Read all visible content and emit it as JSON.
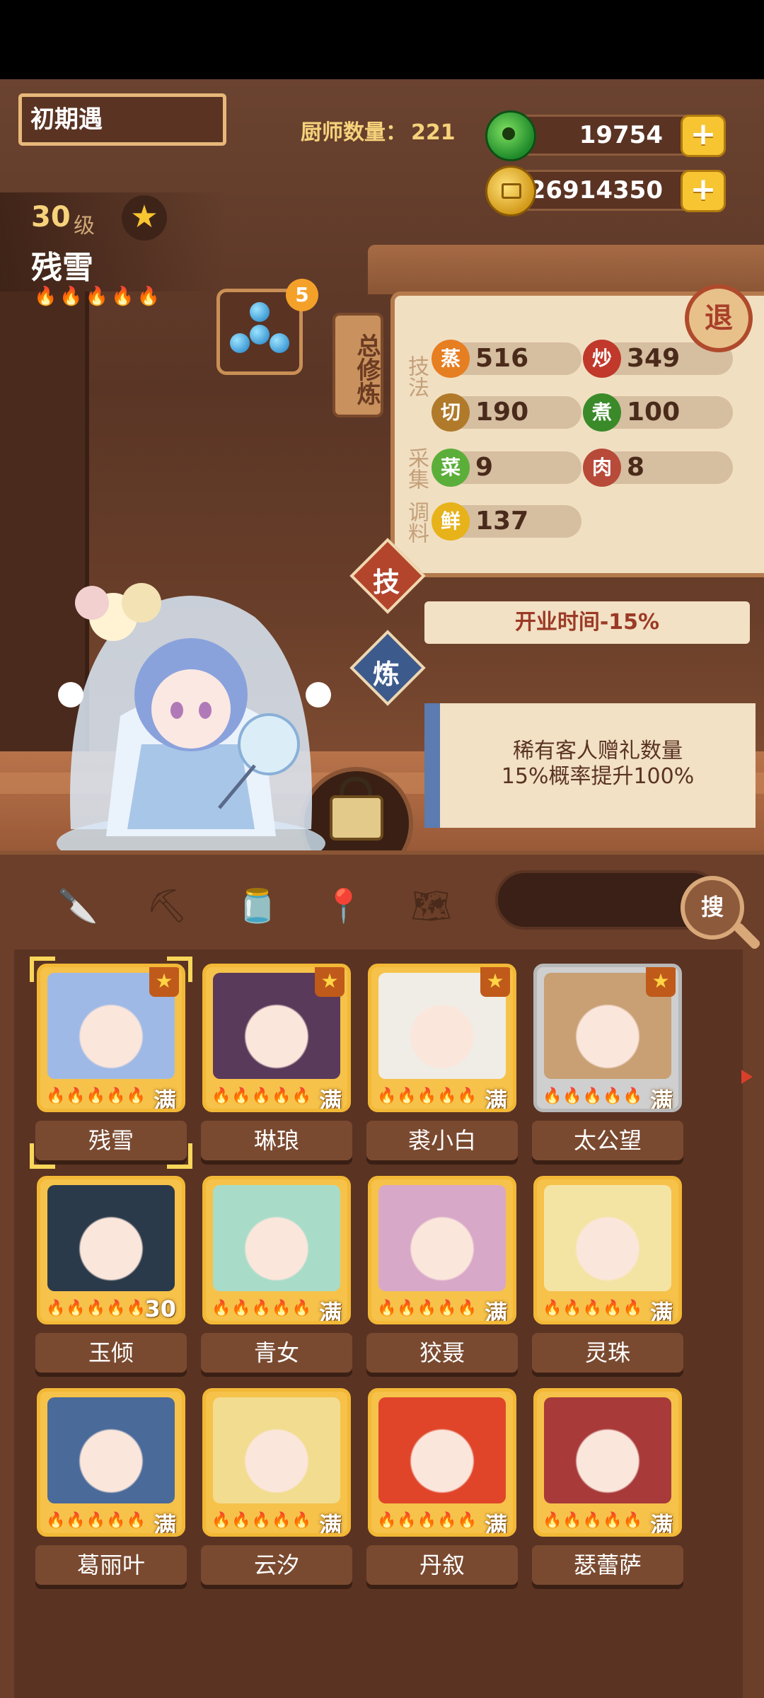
{
  "header": {
    "title": "初期遇",
    "chef_count_label": "厨师数量：",
    "chef_count_value": "221"
  },
  "currency": {
    "jade": "19754",
    "coins": "26914350",
    "plus_label": "+"
  },
  "chef": {
    "level": "30",
    "level_unit": "级",
    "name": "残雪",
    "flames": "🔥🔥🔥🔥🔥",
    "equipment_count": "5"
  },
  "cultivation": {
    "tab_label": "总修炼",
    "section_skill": "技法",
    "section_gather": "采集",
    "section_season": "调料",
    "stats": [
      {
        "icon": "蒸",
        "value": "516",
        "color": "#e67e22"
      },
      {
        "icon": "炒",
        "value": "349",
        "color": "#c0392b"
      },
      {
        "icon": "切",
        "value": "190",
        "color": "#b07a2a"
      },
      {
        "icon": "煮",
        "value": "100",
        "color": "#3a8a2a"
      },
      {
        "icon": "菜",
        "value": "9",
        "color": "#5cae3a"
      },
      {
        "icon": "肉",
        "value": "8",
        "color": "#b84a3a"
      },
      {
        "icon": "鲜",
        "value": "137",
        "color": "#e7b21a"
      }
    ]
  },
  "actions": {
    "skill_label": "技",
    "refine_label": "炼",
    "back_label": "退",
    "skill_effect": "开业时间-15%",
    "refine_line1": "稀有客人赠礼数量",
    "refine_line2": "15%概率提升100%"
  },
  "filters": {
    "icons": [
      "knife-filter-icon",
      "shovel-filter-icon",
      "jar-filter-icon",
      "location-filter-icon",
      "map-filter-icon"
    ],
    "search_label": "搜"
  },
  "chef_list": [
    {
      "name": "残雪",
      "badge": "满",
      "color": "#9fb9e6"
    },
    {
      "name": "琳琅",
      "badge": "满",
      "color": "#5a3a5a"
    },
    {
      "name": "裘小白",
      "badge": "满",
      "color": "#f0ece6"
    },
    {
      "name": "太公望",
      "badge": "满",
      "color": "#c8a074"
    },
    {
      "name": "玉倾",
      "badge": "30",
      "color": "#2a3a4a"
    },
    {
      "name": "青女",
      "badge": "满",
      "color": "#a8dcc8"
    },
    {
      "name": "狡聂",
      "badge": "满",
      "color": "#d8a8c8"
    },
    {
      "name": "灵珠",
      "badge": "满",
      "color": "#f4e4a4"
    },
    {
      "name": "葛丽叶",
      "badge": "满",
      "color": "#4a6a9a"
    },
    {
      "name": "云汐",
      "badge": "满",
      "color": "#f2dc90"
    },
    {
      "name": "丹叙",
      "badge": "满",
      "color": "#e0452a"
    },
    {
      "name": "瑟蕾萨",
      "badge": "满",
      "color": "#a83a3a"
    }
  ],
  "card_flames": "🔥🔥🔥🔥🔥",
  "star": "★"
}
